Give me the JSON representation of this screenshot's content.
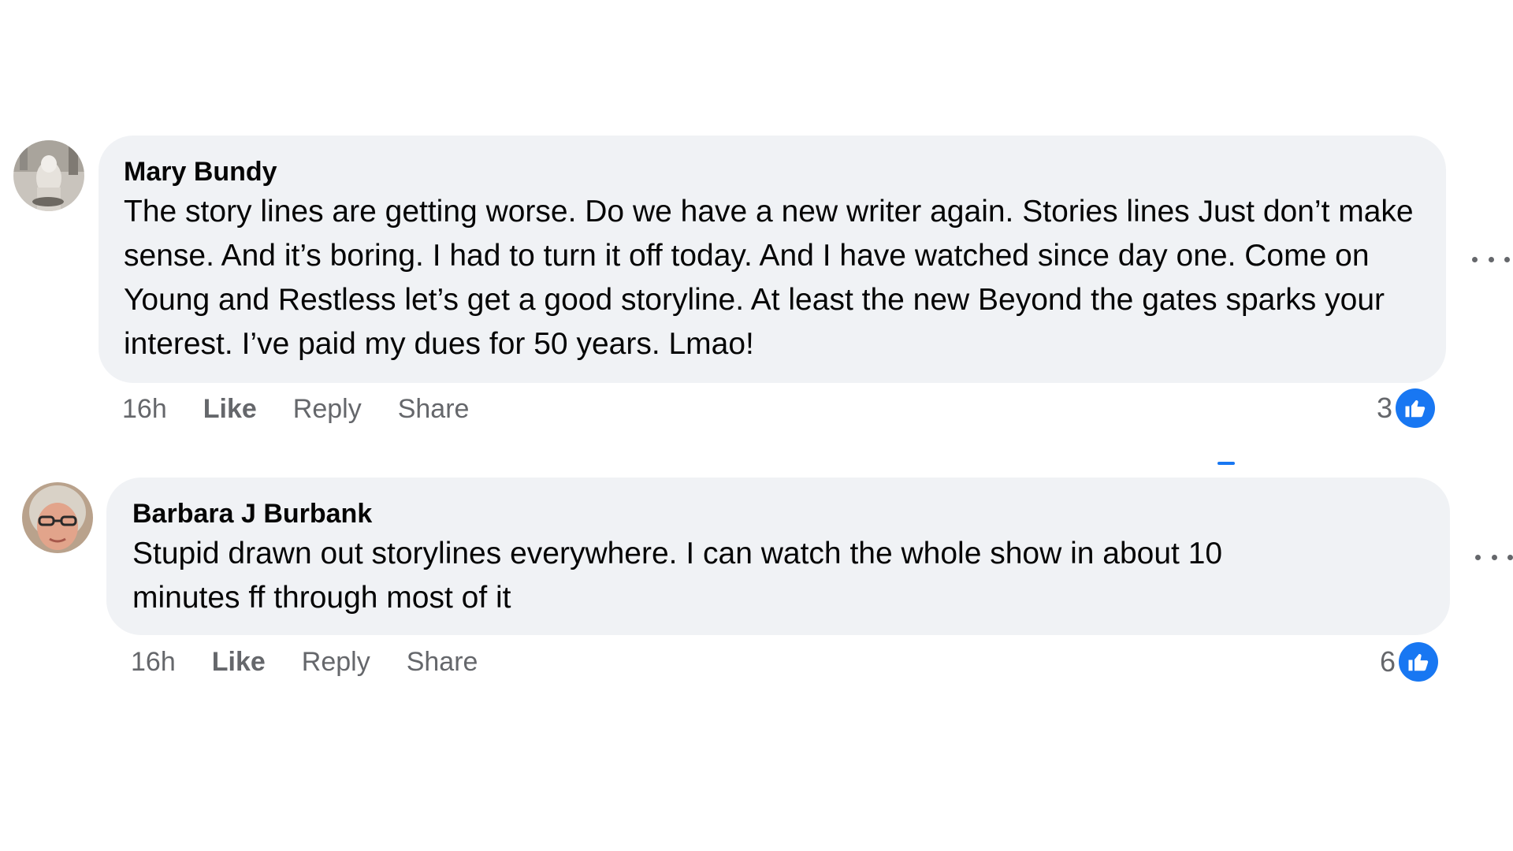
{
  "comments": [
    {
      "author": "Mary Bundy",
      "text": "The story lines are getting worse. Do we have a new writer again. Stories lines Just don’t make sense. And it’s boring. I had to turn it off today. And I have watched since day one. Come on Young and Restless let’s get a good storyline. At least the new Beyond the gates sparks your interest. I’ve paid my dues for 50 years. Lmao!",
      "time": "16h",
      "like_label": "Like",
      "reply_label": "Reply",
      "share_label": "Share",
      "reaction_count": "3",
      "reaction_icon": "thumbs-up-icon"
    },
    {
      "author": "Barbara J Burbank",
      "text": "Stupid drawn out storylines everywhere. I can watch the whole show in about 10 minutes ff through most of it",
      "time": "16h",
      "like_label": "Like",
      "reply_label": "Reply",
      "share_label": "Share",
      "reaction_count": "6",
      "reaction_icon": "thumbs-up-icon"
    }
  ],
  "colors": {
    "bubble": "#f0f2f5",
    "meta_text": "#65676b",
    "like_blue": "#1877f2",
    "text": "#050505"
  }
}
